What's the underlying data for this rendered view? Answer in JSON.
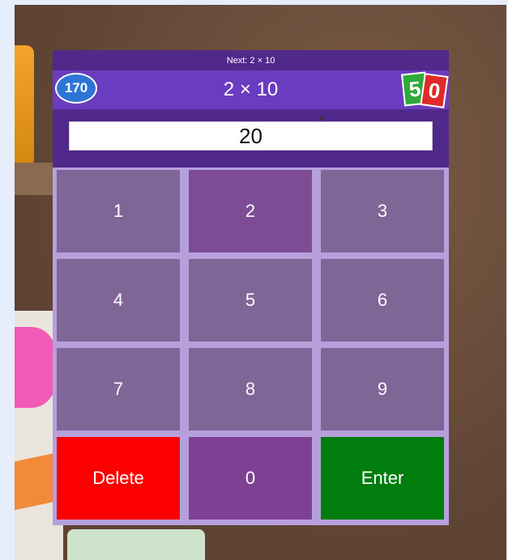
{
  "game": {
    "next_label": "Next: 2 × 10",
    "problem": "2 × 10",
    "score": "170",
    "logo_left": "5",
    "logo_right": "0",
    "answer": "20"
  },
  "keypad": {
    "k1": "1",
    "k2": "2",
    "k3": "3",
    "k4": "4",
    "k5": "5",
    "k6": "6",
    "k7": "7",
    "k8": "8",
    "k9": "9",
    "delete": "Delete",
    "k0": "0",
    "enter": "Enter"
  },
  "colors": {
    "header": "#51298a",
    "problem_bar": "#6a3cbf",
    "key": "#7f6697",
    "delete": "#fb0100",
    "enter": "#007d0c"
  }
}
